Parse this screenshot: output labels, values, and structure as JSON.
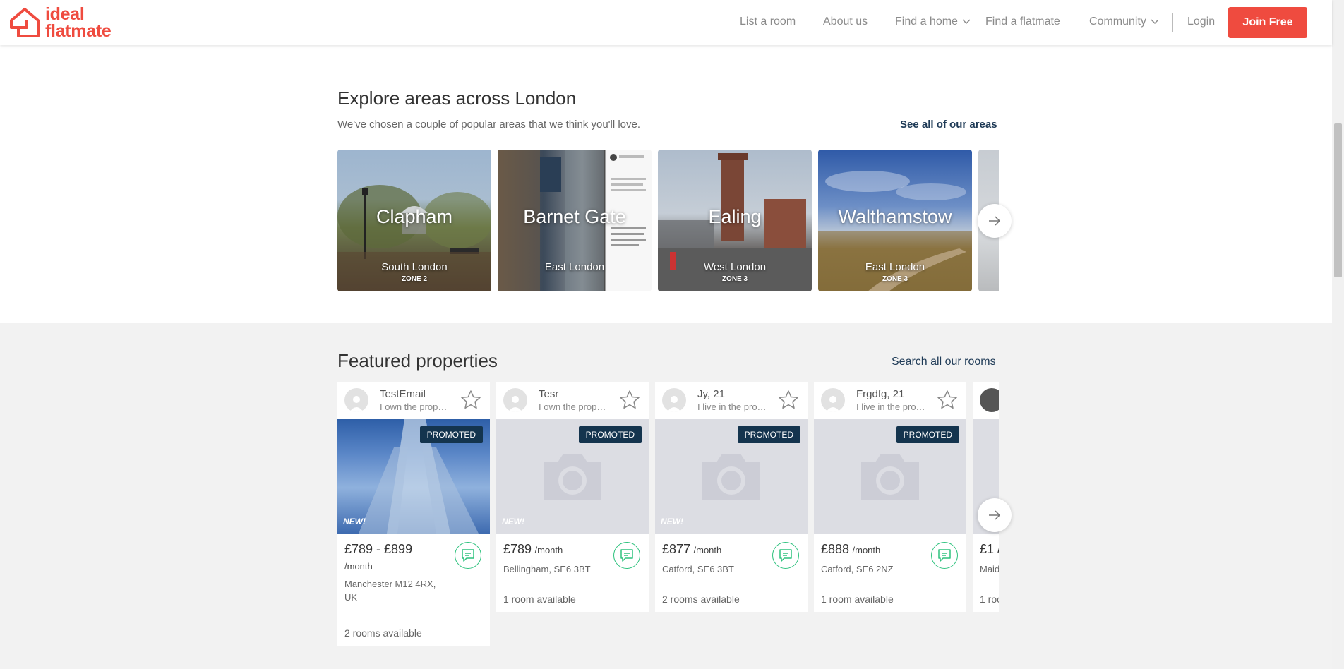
{
  "brand": {
    "line1": "ideal",
    "line2": "flatmate",
    "color": "#ef4b3f"
  },
  "nav": {
    "list_room": "List a room",
    "about": "About us",
    "find_home": "Find a home",
    "find_flatmate": "Find a flatmate",
    "community": "Community",
    "login": "Login",
    "join": "Join Free"
  },
  "explore": {
    "title": "Explore areas across London",
    "subtitle": "We've chosen a couple of popular areas that we think you'll love.",
    "see_all": "See all of our areas",
    "areas": [
      {
        "name": "Clapham",
        "region": "South London",
        "zone": "ZONE 2"
      },
      {
        "name": "Barnet Gate",
        "region": "East London",
        "zone": ""
      },
      {
        "name": "Ealing",
        "region": "West London",
        "zone": "ZONE 3"
      },
      {
        "name": "Walthamstow",
        "region": "East London",
        "zone": "ZONE 3"
      }
    ]
  },
  "featured": {
    "title": "Featured properties",
    "search_all": "Search all our rooms",
    "promoted_label": "PROMOTED",
    "new_label": "NEW!",
    "per_month": "/month",
    "cards": [
      {
        "user": "TestEmail",
        "role": "I own the prope...",
        "price": "£789 - £899",
        "location_1": "Manchester M12 4RX,",
        "location_2": "UK",
        "rooms": "2 rooms available"
      },
      {
        "user": "Tesr",
        "role": "I own the prope...",
        "price": "£789",
        "location_1": "Bellingham, SE6 3BT",
        "rooms": "1 room available"
      },
      {
        "user": "Jy, 21",
        "role": "I live in the prop...",
        "price": "£877",
        "location_1": "Catford, SE6 3BT",
        "rooms": "2 rooms available"
      },
      {
        "user": "Frgdfg, 21",
        "role": "I live in the prop...",
        "price": "£888",
        "location_1": "Catford, SE6 2NZ",
        "rooms": "1 room available"
      },
      {
        "price": "£1 /",
        "location_1": "Maid",
        "rooms": "1 roo"
      }
    ]
  }
}
